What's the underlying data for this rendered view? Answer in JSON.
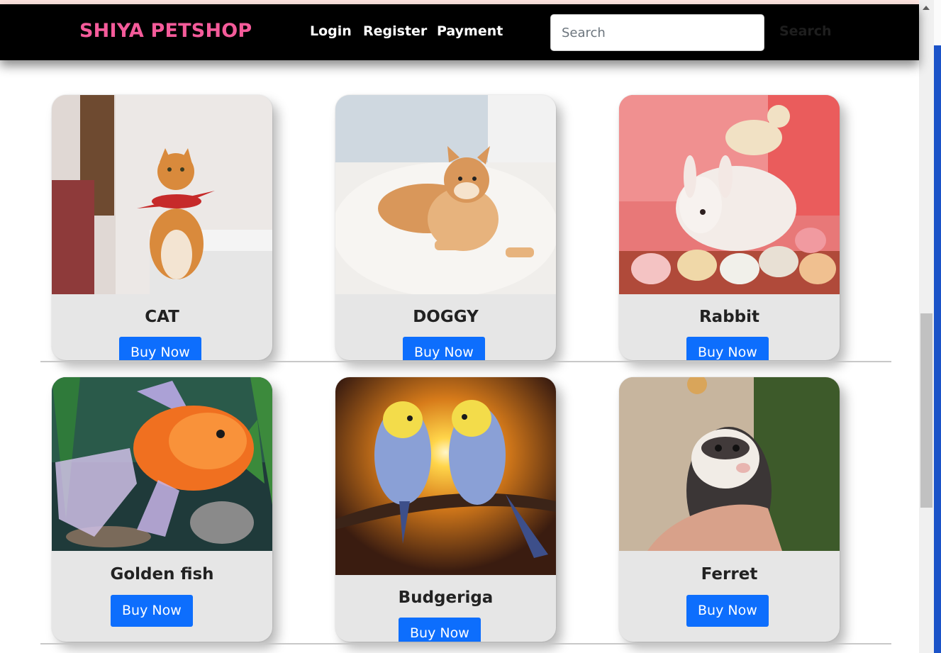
{
  "brand": "SHIYA PETSHOP",
  "nav": {
    "login": "Login",
    "register": "Register",
    "payment": "Payment"
  },
  "search": {
    "placeholder": "Search",
    "button": "Search"
  },
  "products": [
    {
      "name": "CAT",
      "button": "Buy Now"
    },
    {
      "name": "DOGGY",
      "button": "Buy Now"
    },
    {
      "name": "Rabbit",
      "button": "Buy Now"
    },
    {
      "name": "Golden fish",
      "button": "Buy Now"
    },
    {
      "name": "Budgeriga",
      "button": "Buy Now"
    },
    {
      "name": "Ferret",
      "button": "Buy Now"
    }
  ],
  "colors": {
    "brand": "#f45b9a",
    "button": "#0d6efd",
    "card": "#e6e6e6",
    "navbar": "#000000"
  }
}
